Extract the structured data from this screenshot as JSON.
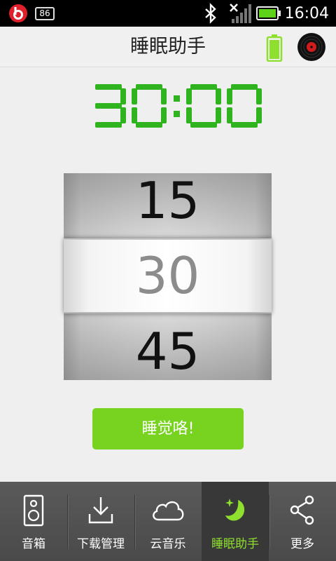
{
  "status_bar": {
    "battery_level_badge": "86",
    "time": "16:04",
    "icons": [
      "beats-audio-icon",
      "battery-badge-icon",
      "bluetooth-icon",
      "signal-icon",
      "battery-icon"
    ]
  },
  "header": {
    "title": "睡眠助手",
    "icons": [
      "battery-status-icon",
      "vinyl-record-icon"
    ]
  },
  "timer": {
    "display": "30:00",
    "color": "#2fb41f"
  },
  "picker": {
    "prev": "15",
    "selected": "30",
    "next": "45"
  },
  "sleep_button": {
    "label": "睡觉咯!",
    "color": "#77d31f"
  },
  "bottom_nav": {
    "items": [
      {
        "label": "音箱",
        "icon": "speaker-icon",
        "active": false
      },
      {
        "label": "下载管理",
        "icon": "download-icon",
        "active": false
      },
      {
        "label": "云音乐",
        "icon": "cloud-icon",
        "active": false
      },
      {
        "label": "睡眠助手",
        "icon": "moon-star-icon",
        "active": true
      },
      {
        "label": "更多",
        "icon": "share-icon",
        "active": false
      }
    ],
    "active_color": "#8fdf2e"
  }
}
